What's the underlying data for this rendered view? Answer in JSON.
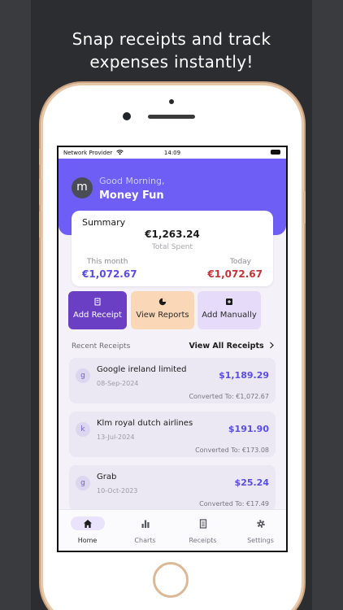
{
  "marketing": {
    "headline_line1": "Snap receipts and track",
    "headline_line2": "expenses instantly!"
  },
  "status_bar": {
    "carrier": "Network Provider",
    "time": "14:09",
    "icons": [
      "wifi-icon",
      "battery-icon"
    ]
  },
  "header": {
    "avatar_letter": "m",
    "greeting": "Good Morning,",
    "user_name": "Money Fun"
  },
  "summary": {
    "title": "Summary",
    "total": "€1,263.24",
    "total_label": "Total Spent",
    "month_label": "This month",
    "month_value": "€1,072.67",
    "today_label": "Today",
    "today_value": "€1,072.67"
  },
  "actions": [
    {
      "label": "Add Receipt",
      "icon": "receipt-icon"
    },
    {
      "label": "View Reports",
      "icon": "pie-chart-icon"
    },
    {
      "label": "Add Manually",
      "icon": "plus-square-icon"
    }
  ],
  "recent": {
    "label": "Recent Receipts",
    "view_all": "View All Receipts"
  },
  "receipts": [
    {
      "letter": "g",
      "name": "Google ireland limited",
      "date": "08-Sep-2024",
      "amount": "$1,189.29",
      "converted": "Converted To: €1,072.67"
    },
    {
      "letter": "k",
      "name": "Klm royal dutch airlines",
      "date": "13-Jul-2024",
      "amount": "$191.90",
      "converted": "Converted To: €173.08"
    },
    {
      "letter": "g",
      "name": "Grab",
      "date": "10-Oct-2023",
      "amount": "$25.24",
      "converted": "Converted To: €17.49"
    }
  ],
  "tabs": [
    {
      "label": "Home",
      "icon": "home-icon",
      "active": true
    },
    {
      "label": "Charts",
      "icon": "bar-chart-icon",
      "active": false
    },
    {
      "label": "Receipts",
      "icon": "receipt-icon",
      "active": false
    },
    {
      "label": "Settings",
      "icon": "gear-icon",
      "active": false
    }
  ],
  "colors": {
    "accent": "#6e5ef5",
    "amount_purple": "#5a4de2",
    "today_red": "#c3343a",
    "add_receipt_bg": "#6a3fc4",
    "view_reports_bg": "#fad7b6",
    "add_manually_bg": "#e6dcfa"
  }
}
